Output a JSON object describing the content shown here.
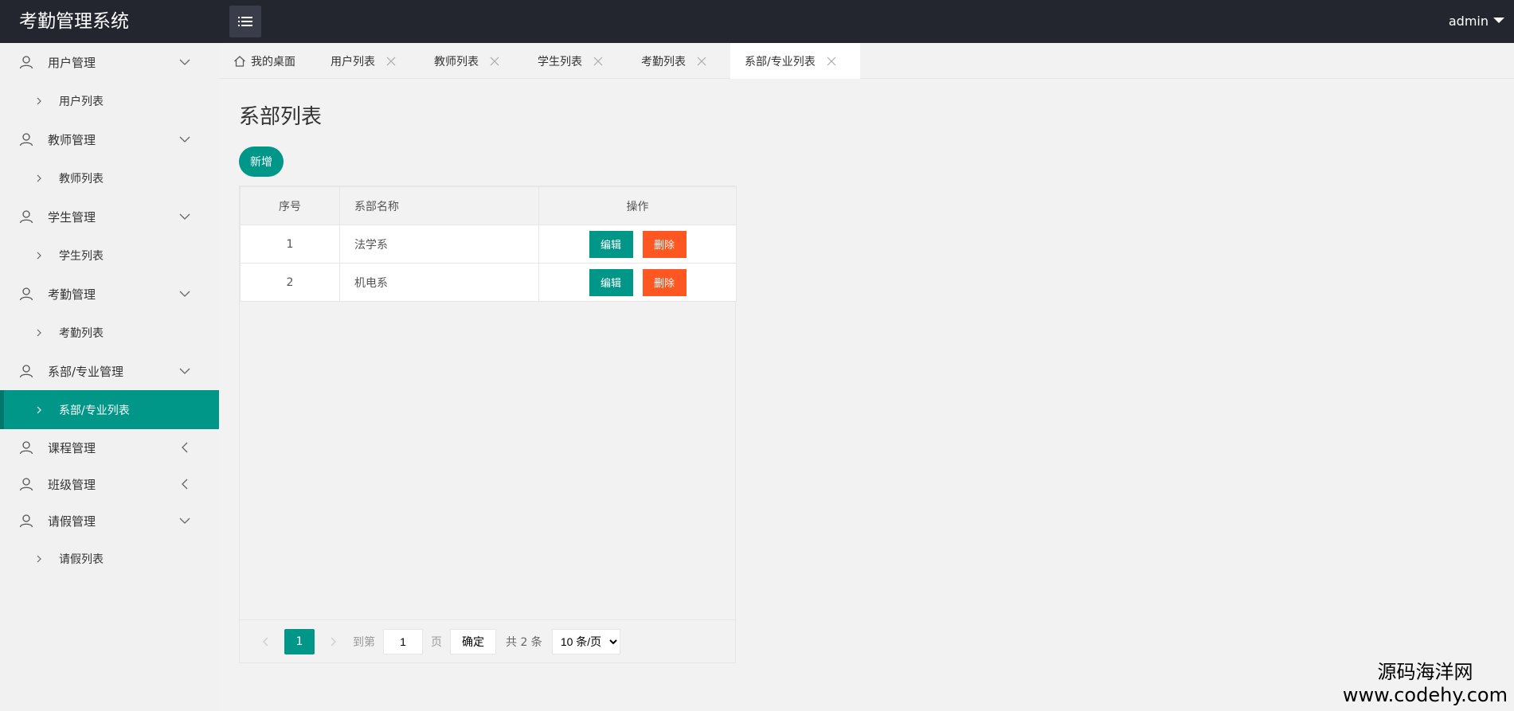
{
  "header": {
    "app_title": "考勤管理系统",
    "user_name": "admin"
  },
  "sidebar": {
    "groups": [
      {
        "label": "用户管理",
        "sub": "用户列表"
      },
      {
        "label": "教师管理",
        "sub": "教师列表"
      },
      {
        "label": "学生管理",
        "sub": "学生列表"
      },
      {
        "label": "考勤管理",
        "sub": "考勤列表"
      },
      {
        "label": "系部/专业管理",
        "sub": "系部/专业列表"
      },
      {
        "label": "课程管理"
      },
      {
        "label": "班级管理"
      },
      {
        "label": "请假管理",
        "sub": "请假列表"
      }
    ]
  },
  "tabs": [
    {
      "label": "我的桌面"
    },
    {
      "label": "用户列表"
    },
    {
      "label": "教师列表"
    },
    {
      "label": "学生列表"
    },
    {
      "label": "考勤列表"
    },
    {
      "label": "系部/专业列表"
    }
  ],
  "page": {
    "title": "系部列表",
    "add_button": "新增"
  },
  "table": {
    "headers": [
      "序号",
      "系部名称",
      "操作"
    ],
    "rows": [
      {
        "index": "1",
        "name": "法学系",
        "edit": "编辑",
        "delete": "删除"
      },
      {
        "index": "2",
        "name": "机电系",
        "edit": "编辑",
        "delete": "删除"
      }
    ]
  },
  "pagination": {
    "current_page": "1",
    "goto_label": "到第",
    "goto_value": "1",
    "page_label": "页",
    "confirm": "确定",
    "total": "共 2 条",
    "page_size": "10 条/页"
  },
  "watermark": {
    "line1": "源码海洋网",
    "line2": "www.codehy.com"
  },
  "colors": {
    "header_bg": "#23262e",
    "primary": "#009688",
    "danger": "#ff5722"
  }
}
